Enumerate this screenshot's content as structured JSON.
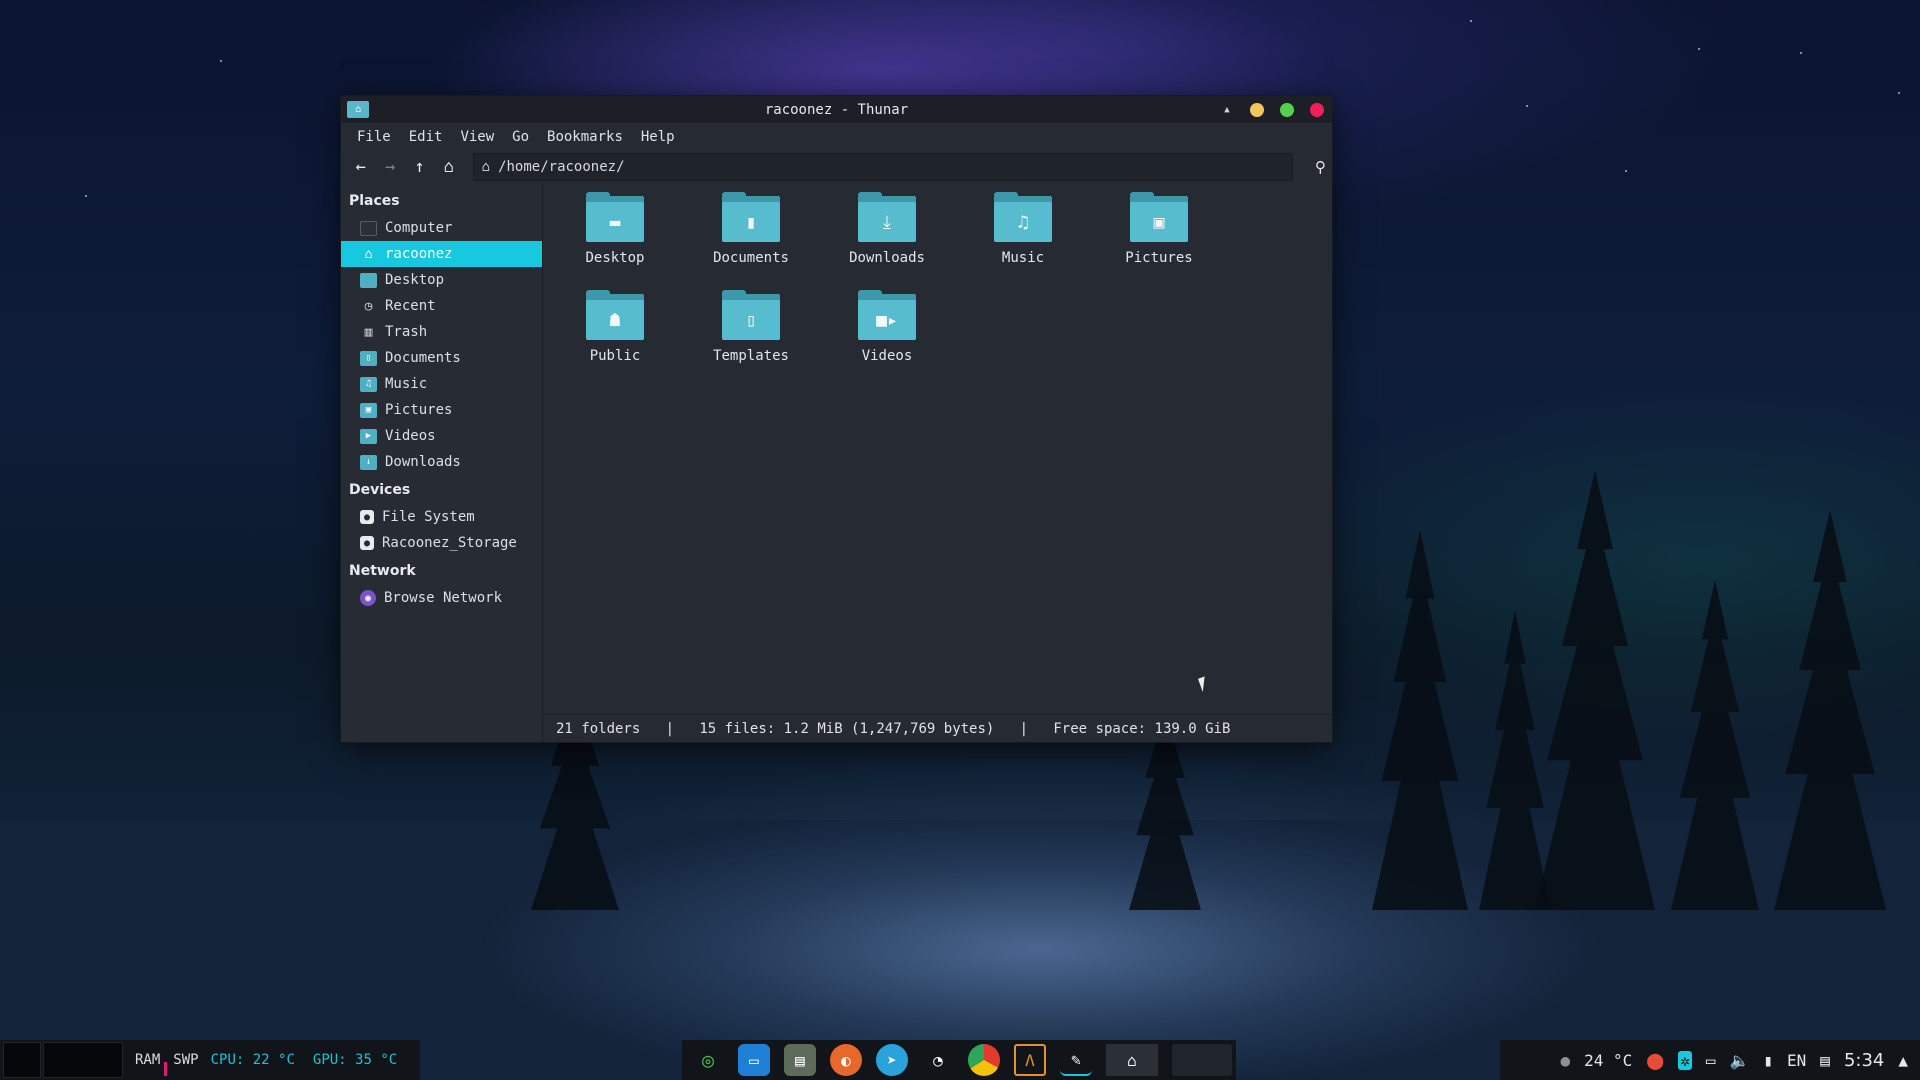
{
  "window": {
    "title": "racoonez - Thunar",
    "controls": {
      "minimize_color": "#f3c65a",
      "maximize_color": "#56d04c",
      "close_color": "#f01e5a"
    }
  },
  "menubar": {
    "items": [
      "File",
      "Edit",
      "View",
      "Go",
      "Bookmarks",
      "Help"
    ]
  },
  "toolbar": {
    "path": "/home/racoonez/"
  },
  "sidebar": {
    "places_heading": "Places",
    "places": [
      {
        "label": "Computer",
        "icon": "computer-icon"
      },
      {
        "label": "racoonez",
        "icon": "home-icon",
        "active": true
      },
      {
        "label": "Desktop",
        "icon": "desktop-icon"
      },
      {
        "label": "Recent",
        "icon": "clock-icon"
      },
      {
        "label": "Trash",
        "icon": "trash-icon"
      },
      {
        "label": "Documents",
        "icon": "documents-folder-icon"
      },
      {
        "label": "Music",
        "icon": "music-folder-icon"
      },
      {
        "label": "Pictures",
        "icon": "pictures-folder-icon"
      },
      {
        "label": "Videos",
        "icon": "videos-folder-icon"
      },
      {
        "label": "Downloads",
        "icon": "downloads-folder-icon"
      }
    ],
    "devices_heading": "Devices",
    "devices": [
      {
        "label": "File System",
        "icon": "drive-icon"
      },
      {
        "label": "Racoonez_Storage",
        "icon": "drive-icon"
      }
    ],
    "network_heading": "Network",
    "network": [
      {
        "label": "Browse Network",
        "icon": "network-icon"
      }
    ]
  },
  "files": [
    {
      "label": "Desktop",
      "icon": "desktop-folder-icon"
    },
    {
      "label": "Documents",
      "icon": "documents-folder-icon"
    },
    {
      "label": "Downloads",
      "icon": "downloads-folder-icon"
    },
    {
      "label": "Music",
      "icon": "music-folder-icon"
    },
    {
      "label": "Pictures",
      "icon": "pictures-folder-icon"
    },
    {
      "label": "Public",
      "icon": "public-folder-icon"
    },
    {
      "label": "Templates",
      "icon": "templates-folder-icon"
    },
    {
      "label": "Videos",
      "icon": "videos-folder-icon"
    }
  ],
  "statusbar": {
    "folders": "21 folders",
    "files": "15 files: 1.2 MiB (1,247,769 bytes)",
    "free": "Free space: 139.0 GiB",
    "separator": "|"
  },
  "taskbar": {
    "ram": "RAM",
    "swp": "SWP",
    "cpu": "CPU: 22 °C",
    "gpu": "GPU: 35 °C",
    "weather": "24 °C",
    "lang": "EN",
    "clock": "5:34",
    "accent": "#17c9de"
  }
}
